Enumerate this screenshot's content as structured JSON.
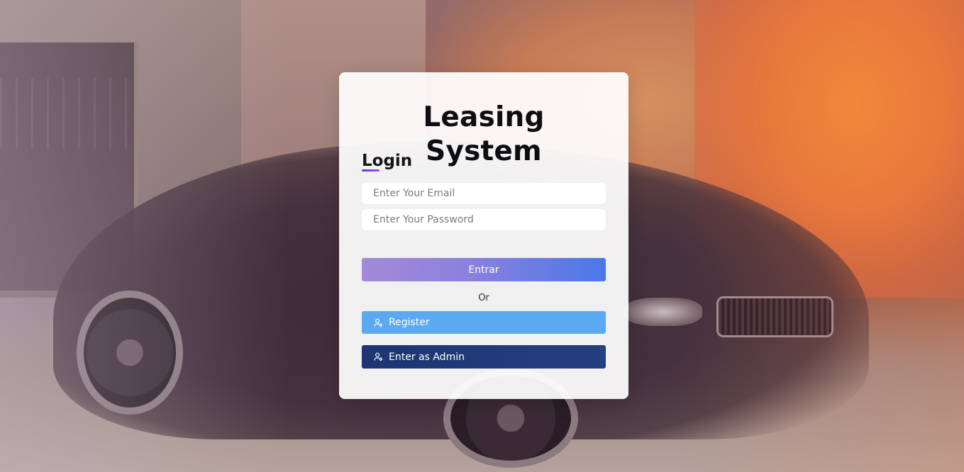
{
  "card": {
    "title": "Leasing System",
    "login_heading": "Login",
    "email_placeholder": "Enter Your Email",
    "password_placeholder": "Enter Your Password",
    "submit_label": "Entrar",
    "or_label": "Or",
    "register_label": "Register",
    "admin_label": "Enter as Admin",
    "register_icon": "user-cog-icon",
    "admin_icon": "user-cog-icon"
  },
  "colors": {
    "submit_gradient_start": "#a48ad8",
    "submit_gradient_end": "#4a78e8",
    "register_bg": "#5aa9f2",
    "admin_bg": "#1d3572",
    "heading_underline": "#6a3cd8"
  }
}
